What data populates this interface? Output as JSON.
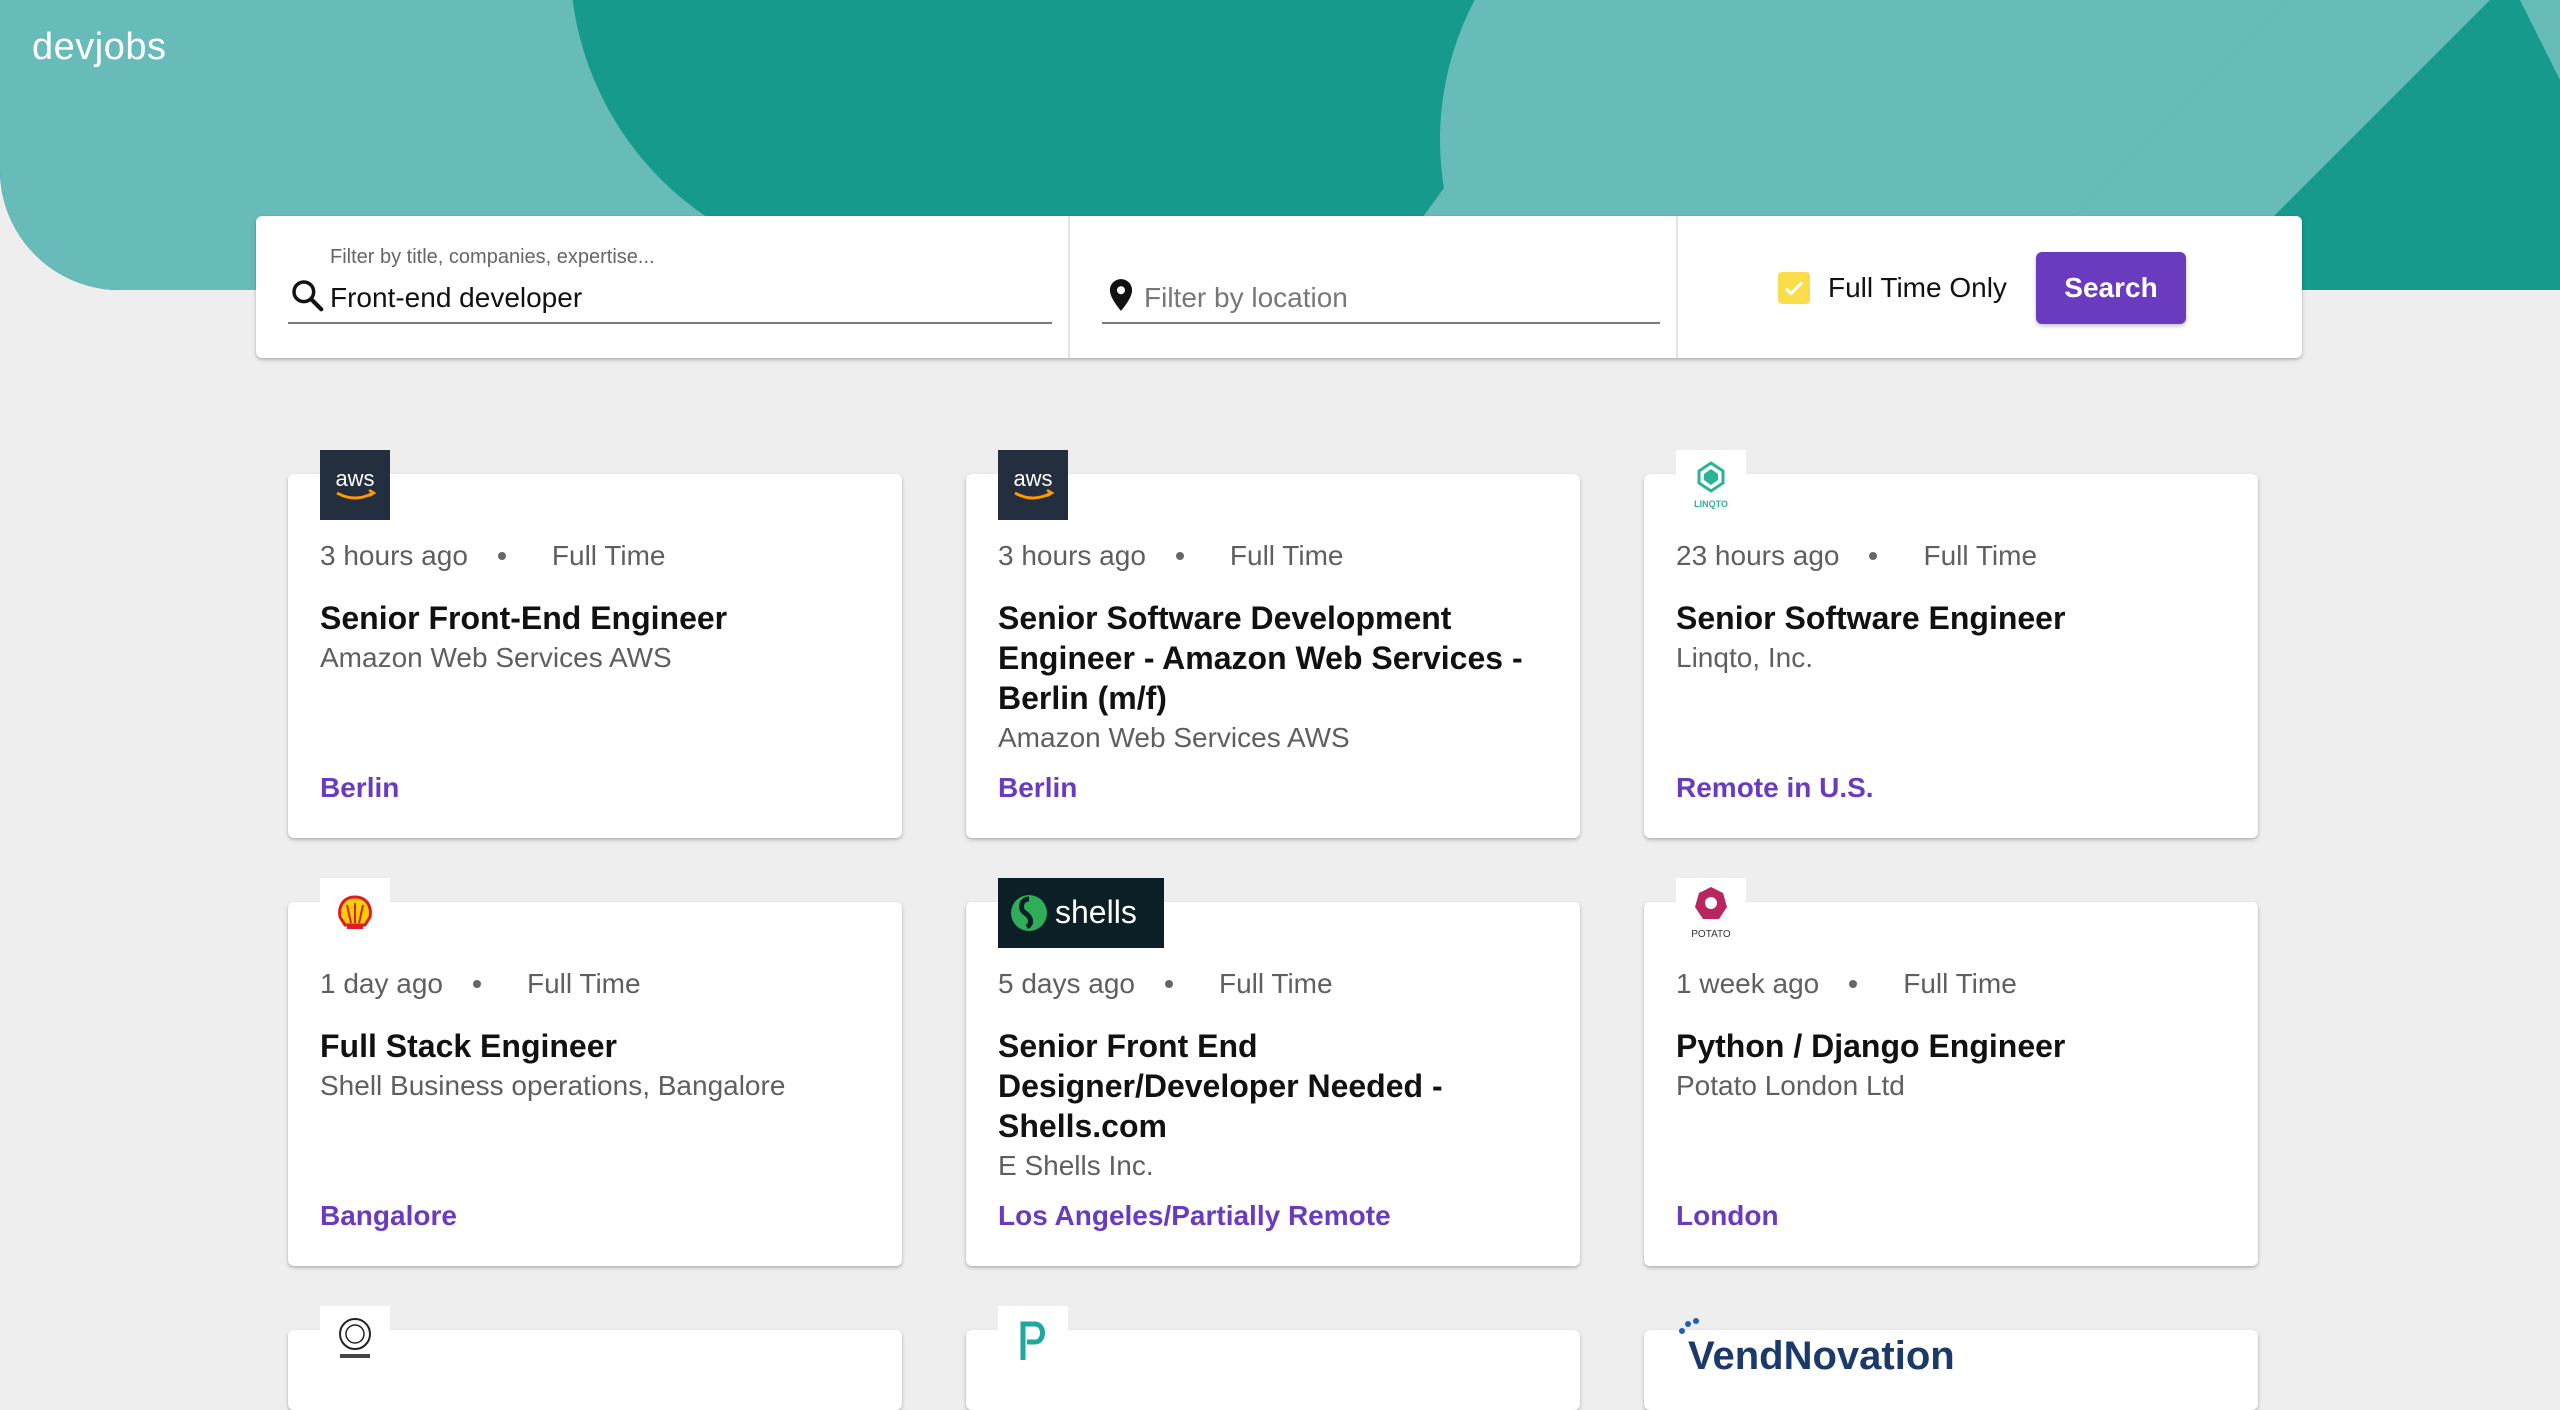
{
  "app": {
    "logo": "devjobs"
  },
  "search": {
    "title_label": "Filter by title, companies, expertise...",
    "title_value": "Front-end developer",
    "location_placeholder": "Filter by location",
    "fulltime_label": "Full Time Only",
    "fulltime_checked": true,
    "search_button": "Search"
  },
  "colors": {
    "header_dark": "#159a8c",
    "header_light": "#67bbb9",
    "accent": "#6a3bbf",
    "checkbox": "#fbdc49",
    "background": "#eeeeee"
  },
  "jobs": [
    {
      "posted": "3 hours ago",
      "type": "Full Time",
      "title": "Senior Front-End Engineer",
      "company": "Amazon Web Services AWS",
      "location": "Berlin",
      "logo_icon": "aws-logo",
      "logo_text": "aws"
    },
    {
      "posted": "3 hours ago",
      "type": "Full Time",
      "title": "Senior Software Development Engineer - Amazon Web Services - Berlin (m/f)",
      "company": "Amazon Web Services AWS",
      "location": "Berlin",
      "logo_icon": "aws-logo",
      "logo_text": "aws"
    },
    {
      "posted": "23 hours ago",
      "type": "Full Time",
      "title": "Senior Software Engineer",
      "company": "Linqto, Inc.",
      "location": "Remote in U.S.",
      "logo_icon": "linqto-logo",
      "logo_text": "LINQTO"
    },
    {
      "posted": "1 day ago",
      "type": "Full Time",
      "title": "Full Stack Engineer",
      "company": "Shell Business operations, Bangalore",
      "location": "Bangalore",
      "logo_icon": "shell-logo",
      "logo_text": ""
    },
    {
      "posted": "5 days ago",
      "type": "Full Time",
      "title": "Senior Front End Designer/Developer Needed - Shells.com",
      "company": "E Shells Inc.",
      "location": "Los Angeles/Partially Remote",
      "logo_icon": "shells-logo",
      "logo_text": "shells"
    },
    {
      "posted": "1 week ago",
      "type": "Full Time",
      "title": "Python / Django Engineer",
      "company": "Potato London Ltd",
      "location": "London",
      "logo_icon": "potato-logo",
      "logo_text": "POTATO"
    },
    {
      "logo_icon": "seal-logo",
      "logo_text": ""
    },
    {
      "logo_icon": "p-logo",
      "logo_text": ""
    },
    {
      "logo_icon": "vendnovation-logo",
      "logo_text": "VendNovation"
    }
  ]
}
